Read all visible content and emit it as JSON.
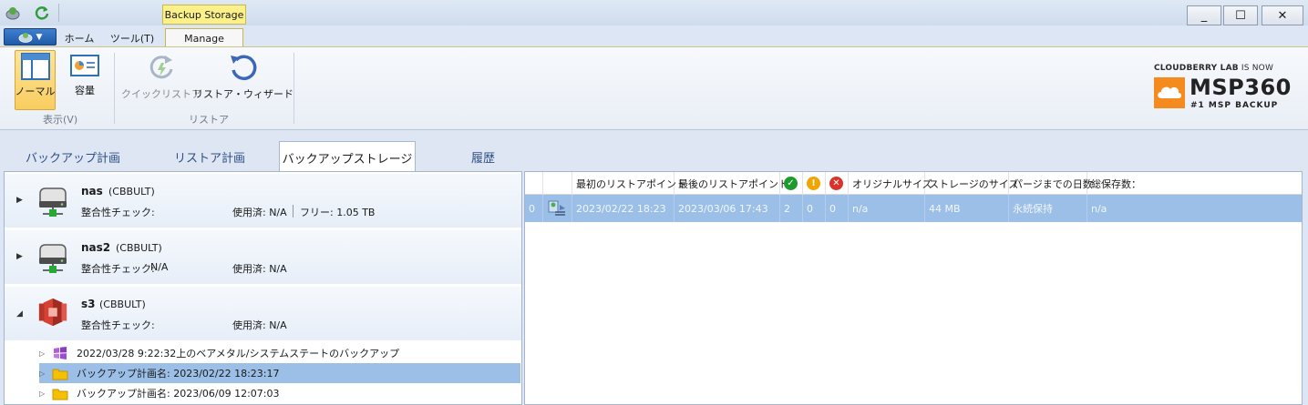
{
  "titlebar": {
    "contextual_tab": "Backup Storage",
    "minimize": "_",
    "maximize": "☐",
    "close": "✕"
  },
  "ribbon_tabs": [
    "ホーム",
    "ツール(T)",
    "Manage"
  ],
  "ribbon": {
    "view_group": {
      "label": "表示(V)",
      "normal": "ノーマル",
      "capacity": "容量"
    },
    "restore_group": {
      "label": "リストア",
      "quick_restore": "クイックリストア",
      "restore_wizard": "リストア・ウィザード"
    }
  },
  "brand": {
    "line1_bold": "CLOUDBERRY LAB",
    "line1_thin": " IS NOW",
    "name": "MSP360",
    "tagline": "#1 MSP BACKUP",
    "accent": "#f58a1f"
  },
  "main_tabs": [
    "バックアップ計画",
    "リストア計画",
    "バックアップストレージ",
    "履歴"
  ],
  "storages": [
    {
      "name": "nas",
      "owner": "(CBBULT)",
      "integrity": "整合性チェック:",
      "integrity_value": "",
      "used": "使用済: N/A",
      "free": "フリー: 1.05 TB",
      "icon": "nas-drive-icon",
      "expanded": false
    },
    {
      "name": "nas2",
      "owner": "(CBBULT)",
      "integrity": "整合性チェック:",
      "integrity_value": "N/A",
      "used": "使用済: N/A",
      "free": "",
      "icon": "nas-drive-icon",
      "expanded": false
    },
    {
      "name": "s3",
      "owner": "(CBBULT)",
      "integrity": "整合性チェック:",
      "integrity_value": "",
      "used": "使用済: N/A",
      "free": "",
      "icon": "amazon-s3-icon",
      "expanded": true
    }
  ],
  "tree_items": [
    {
      "label": "2022/03/28 9:22:32上のベアメタル/システムステートのバックアップ",
      "icon": "windows-icon",
      "selected": false
    },
    {
      "label": "バックアップ計画名: 2023/02/22 18:23:17",
      "icon": "folder-icon",
      "selected": true
    },
    {
      "label": "バックアップ計画名: 2023/06/09 12:07:03",
      "icon": "folder-icon",
      "selected": false
    }
  ],
  "grid": {
    "headers": [
      "最初のリストアポイント",
      "最後のリストアポイント",
      "オリジナルサイズ",
      "ストレージのサイズ",
      "パージまでの日数",
      "総保存数："
    ],
    "status_icons": [
      "success-icon",
      "warning-icon",
      "error-icon"
    ],
    "status_colors": {
      "success": "#1e9a2f",
      "warning": "#f0a500",
      "error": "#d9342b"
    },
    "row": {
      "index": "0",
      "first_restore_point": "2023/02/22 18:23",
      "last_restore_point": "2023/03/06 17:43",
      "success_count": "2",
      "warning_count": "0",
      "error_count": "0",
      "original_size": "n/a",
      "storage_size": "44 MB",
      "days_to_purge": "永続保持",
      "total_versions": "n/a"
    }
  }
}
